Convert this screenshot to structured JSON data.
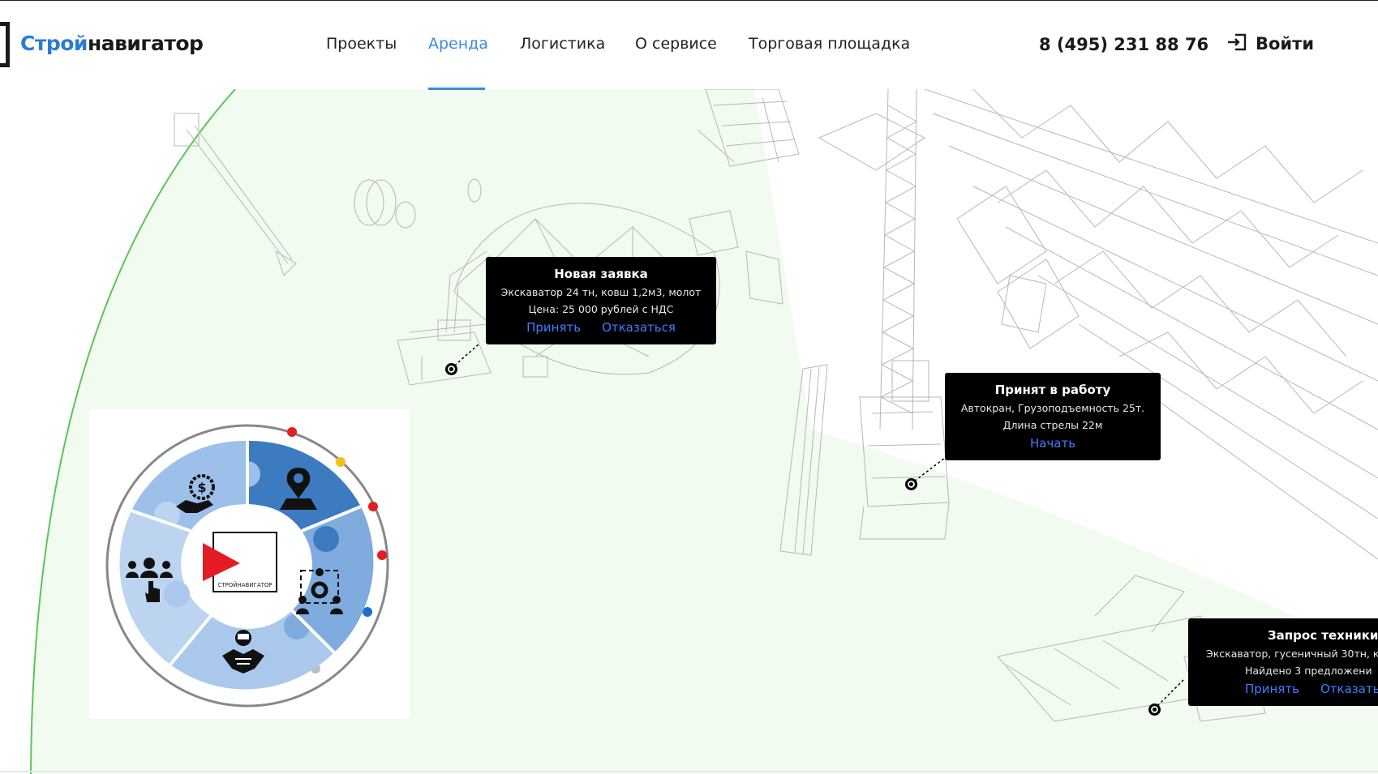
{
  "header": {
    "logo_accent": "Строй",
    "logo_rest": "навигатор",
    "nav": [
      {
        "label": "Проекты",
        "active": false
      },
      {
        "label": "Аренда",
        "active": true
      },
      {
        "label": "Логистика",
        "active": false
      },
      {
        "label": "О сервисе",
        "active": false
      },
      {
        "label": "Торговая площадка",
        "active": false
      }
    ],
    "phone": "8 (495) 231 88 76",
    "login_label": "Войти"
  },
  "cards": {
    "new_request": {
      "title": "Новая заявка",
      "line1": "Экскаватор 24 тн, ковш 1,2м3, молот",
      "line2": "Цена: 25 000 рублей с НДС",
      "accept": "Принять",
      "decline": "Отказаться"
    },
    "in_work": {
      "title": "Принят в работу",
      "line1": "Автокран, Грузоподъемность 25т.",
      "line2": "Длина стрелы 22м",
      "start": "Начать"
    },
    "equipment_request": {
      "title": "Запрос техники",
      "line1": "Экскаватор, гусеничный 30тн, к",
      "line2": "Найдено 3 предложени",
      "accept": "Принять",
      "decline": "Отказать"
    }
  },
  "puzzle": {
    "center_label": "СТРОЙНАВИГАТОР",
    "icons": [
      "money-hand-icon",
      "map-pin-icon",
      "team-gear-icon",
      "handshake-icon",
      "people-click-icon",
      "play-icon"
    ]
  },
  "colors": {
    "accent": "#3a8be0",
    "brand": "#2b7bd6",
    "green_area": "#f1fbef",
    "green_line": "#5cc45a",
    "puzzle_light": "#a9c8ec",
    "puzzle_mid": "#7fabde",
    "puzzle_dark": "#3d7bc0",
    "link": "#3d7fff"
  }
}
